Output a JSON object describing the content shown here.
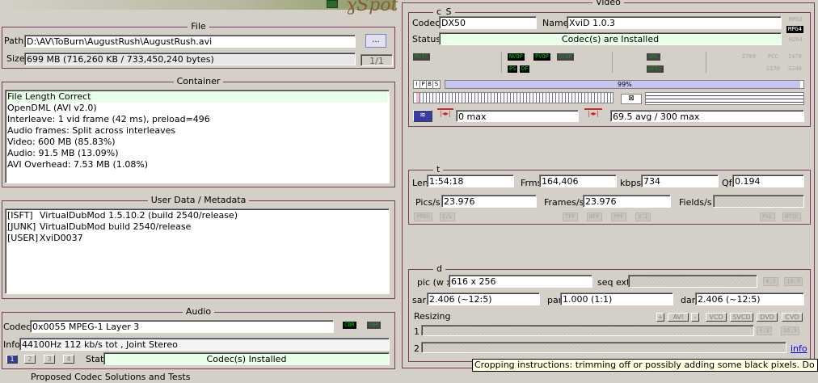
{
  "file": {
    "title": "File",
    "path_label": "Path",
    "path_value": "D:\\AV\\ToBurn\\AugustRush\\AugustRush.avi",
    "browse_label": "...",
    "size_label": "Size",
    "size_value": "699 MB (716,260 KB / 733,450,240 bytes)",
    "part_value": "1/1"
  },
  "container": {
    "title": "Container",
    "lines": [
      "File Length Correct",
      "OpenDML (AVI v2.0)",
      "Interleave: 1 vid frame (42 ms), preload=496",
      "Audio frames: Split across interleaves",
      "Video: 600 MB (85.83%)",
      "Audio: 91.5 MB (13.09%)",
      "AVI Overhead: 7.53 MB (1.08%)"
    ]
  },
  "userdata": {
    "title": "User Data / Metadata",
    "rows": [
      {
        "key": "[ISFT]",
        "value": "VirtualDubMod 1.5.10.2 (build 2540/release)"
      },
      {
        "key": "[JUNK]",
        "value": "VirtualDubMod build 2540/release"
      },
      {
        "key": "[USER]",
        "value": "XviD0037"
      }
    ]
  },
  "audio": {
    "title": "Audio",
    "codec_label": "Codec",
    "codec_value": "0x0055  MPEG-1 Layer 3",
    "cbr": "CBR",
    "vbr": "VBR",
    "info_label": "Info",
    "info_value": "44100Hz  112 kb/s tot , Joint Stereo",
    "stream_buttons": [
      "1",
      "2",
      "3",
      "4"
    ],
    "stat_label": "Stat",
    "stat_value": "Codec(s) Installed"
  },
  "bottom_partial": "Proposed Codec Solutions and Tests",
  "video": {
    "title": "Video",
    "cs_title": "c_S",
    "codec_label": "Codec",
    "codec_value": "DX50",
    "name_label": "Name",
    "name_value": "XviD 1.0.3",
    "status_label": "Status",
    "status_value": "Codec(s) are Installed",
    "fmt_tags": [
      "MPG2",
      "MPG4",
      "H264"
    ],
    "flags": {
      "mvic": "MVIC",
      "nvop": "NVOP",
      "pvop": "PVOP",
      "svop": "SVOP",
      "qpel_top": "GMC",
      "qpel": "QPEL",
      "ps": "PS",
      "df": "DF",
      "i709": "I709",
      "pcc": "PCC",
      "i470": "I470",
      "s170": "S170",
      "s240": "S240"
    },
    "ipbs": [
      "I",
      "P",
      "B",
      "S"
    ],
    "progress_label": "99%",
    "progress_value": 0.99,
    "max_left": "0 max",
    "max_right": "69.5 avg / 300 max",
    "t_title": "t",
    "len_label": "Len",
    "len_value": "1:54:18",
    "frms_label": "Frms",
    "frms_value": "164,406",
    "kbps_label": "kbps",
    "kbps_value": "734",
    "qf_label": "Qf",
    "qf_value": "0.194",
    "pics_label": "Pics/s",
    "pics_value": "23.976",
    "frames_label": "Frames/s",
    "frames_value": "23.976",
    "fields_label": "Fields/s",
    "t_tags_left": [
      "PROG",
      "I/L"
    ],
    "t_tags_mid": [
      "TFF",
      "BFF",
      "PPF",
      "3:2"
    ],
    "t_tags_right": [
      "PAL",
      "NTSC"
    ],
    "d_title": "d",
    "pic_label": "pic (w x",
    "pic_value": "616 x 256",
    "seqext_label": "seq ext",
    "ar_tags": [
      "4:3",
      "16:9"
    ],
    "sar_label": "sar",
    "sar_value": "2.406 (~12:5)",
    "par_label": "par",
    "par_value": "1.000 (1:1)",
    "dar_label": "dar",
    "dar_value": "2.406 (~12:5)",
    "resizing_label": "Resizing",
    "resize_buttons": [
      "+",
      "AVI",
      "-",
      "VCD",
      "SVCD",
      "DVD",
      "CVD"
    ],
    "row1": "1",
    "row2": "2",
    "row1_tags": [
      "4:3",
      "16:9"
    ],
    "info_link": "info"
  },
  "tooltip": "Cropping instructions: trimming off or possibly adding some black pixels. Do this step last."
}
